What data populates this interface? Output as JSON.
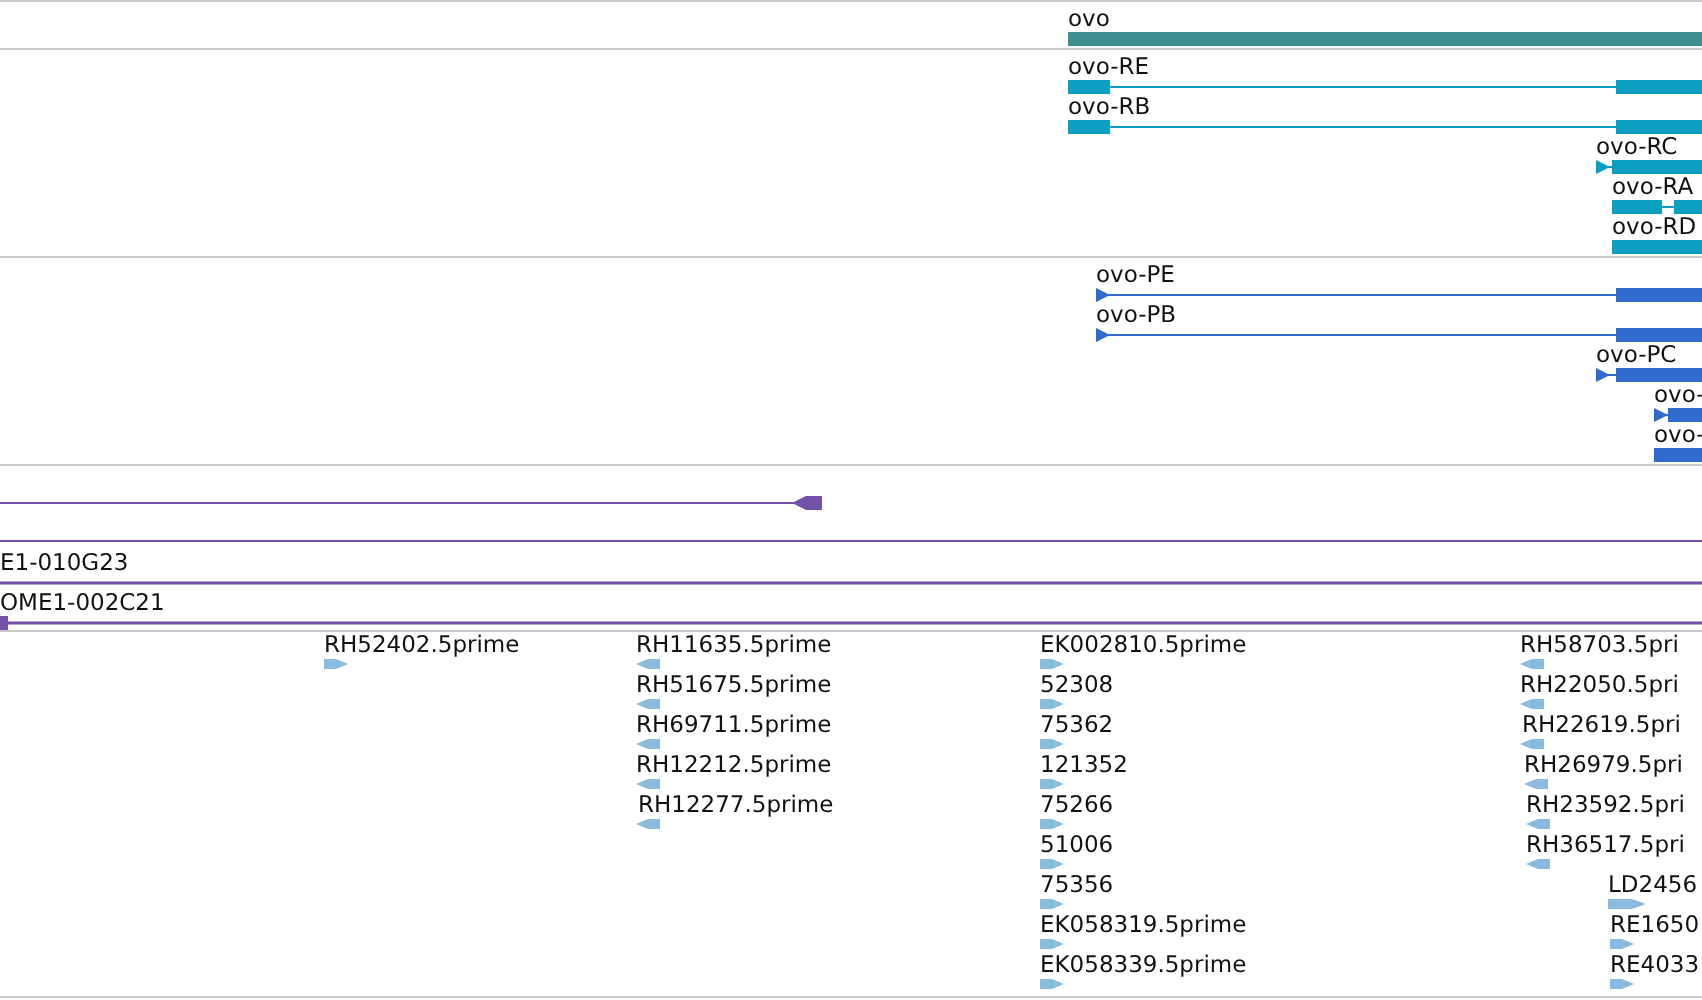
{
  "tracks": [
    {
      "kind": "gene",
      "features": [
        {
          "label": "ovo"
        }
      ]
    },
    {
      "kind": "transcript",
      "features": [
        {
          "label": "ovo-RE",
          "reverse": false
        },
        {
          "label": "ovo-RB",
          "reverse": false
        },
        {
          "label": "ovo-RC",
          "reverse": false
        },
        {
          "label": "ovo-RA",
          "reverse": false
        },
        {
          "label": "ovo-RD",
          "reverse": false
        }
      ]
    },
    {
      "kind": "protein",
      "features": [
        {
          "label": "ovo-PE",
          "reverse": false
        },
        {
          "label": "ovo-PB",
          "reverse": false
        },
        {
          "label": "ovo-PC",
          "reverse": false
        },
        {
          "label": "ovo-",
          "reverse": false
        },
        {
          "label": "ovo-",
          "reverse": false
        }
      ]
    },
    {
      "kind": "segment",
      "features": [
        {
          "reverse": true
        }
      ]
    },
    {
      "kind": "clone",
      "features": [
        {
          "label": "E1-010G23"
        },
        {
          "label": "OME1-002C21"
        }
      ]
    },
    {
      "kind": "est",
      "features": [
        {
          "label": "RH52402.5prime",
          "reverse": false
        },
        {
          "label": "RH11635.5prime",
          "reverse": true
        },
        {
          "label": "RH51675.5prime",
          "reverse": true
        },
        {
          "label": "RH69711.5prime",
          "reverse": true
        },
        {
          "label": "RH12212.5prime",
          "reverse": true
        },
        {
          "label": "RH12277.5prime",
          "reverse": true
        },
        {
          "label": "EK002810.5prime",
          "reverse": false
        },
        {
          "label": "52308",
          "reverse": false
        },
        {
          "label": "75362",
          "reverse": false
        },
        {
          "label": "121352",
          "reverse": false
        },
        {
          "label": "75266",
          "reverse": false
        },
        {
          "label": "51006",
          "reverse": false
        },
        {
          "label": "75356",
          "reverse": false
        },
        {
          "label": "EK058319.5prime",
          "reverse": false
        },
        {
          "label": "EK058339.5prime",
          "reverse": false
        },
        {
          "label": "RH58703.5pri",
          "reverse": true
        },
        {
          "label": "RH22050.5pri",
          "reverse": true
        },
        {
          "label": "RH22619.5pri",
          "reverse": true
        },
        {
          "label": "RH26979.5pri",
          "reverse": true
        },
        {
          "label": "RH23592.5pri",
          "reverse": true
        },
        {
          "label": "RH36517.5pri",
          "reverse": true
        },
        {
          "label": "LD2456",
          "reverse": false
        },
        {
          "label": "RE1650",
          "reverse": false
        },
        {
          "label": "RE4033",
          "reverse": false
        }
      ]
    }
  ]
}
